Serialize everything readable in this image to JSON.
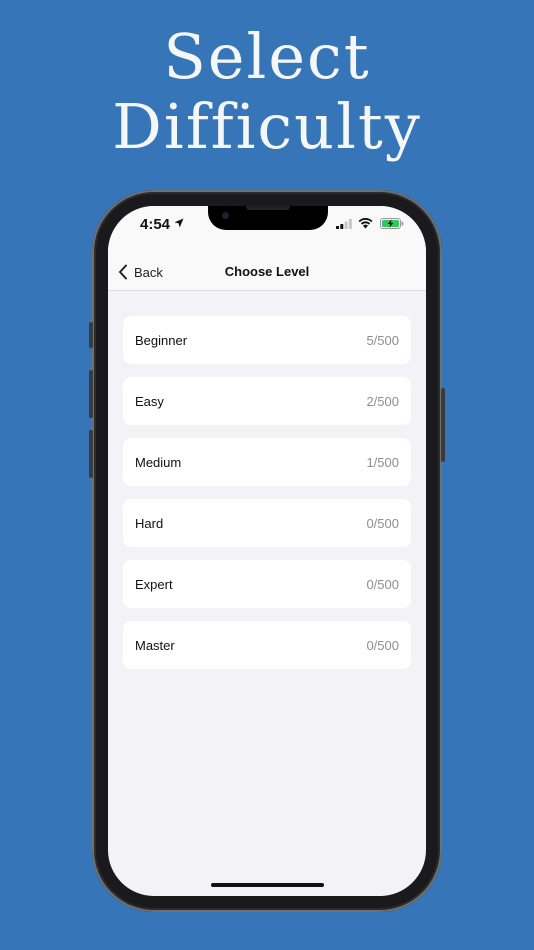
{
  "headline": {
    "line1": "Select",
    "line2": "Difficulty"
  },
  "status_bar": {
    "time": "4:54"
  },
  "nav": {
    "back_label": "Back",
    "title": "Choose Level"
  },
  "levels": [
    {
      "name": "Beginner",
      "progress": "5/500"
    },
    {
      "name": "Easy",
      "progress": "2/500"
    },
    {
      "name": "Medium",
      "progress": "1/500"
    },
    {
      "name": "Hard",
      "progress": "0/500"
    },
    {
      "name": "Expert",
      "progress": "0/500"
    },
    {
      "name": "Master",
      "progress": "0/500"
    }
  ],
  "colors": {
    "background": "#3575b8",
    "screen_bg": "#f2f2f7",
    "card_bg": "#ffffff",
    "count_text": "#8e8e93",
    "battery_charge": "#34c759"
  },
  "icons": [
    "location-arrow-icon",
    "cellular-signal-icon",
    "wifi-icon",
    "battery-charging-icon",
    "chevron-left-icon"
  ]
}
